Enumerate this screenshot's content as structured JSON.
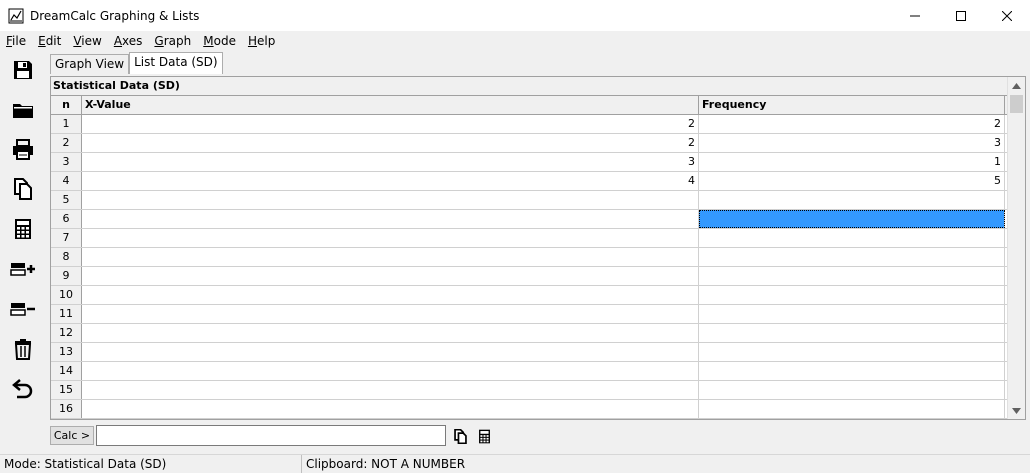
{
  "window": {
    "title": "DreamCalc Graphing & Lists",
    "controls": [
      "minimize-icon",
      "maximize-icon",
      "close-icon"
    ]
  },
  "menubar": {
    "items": [
      {
        "key": "F",
        "rest": "ile"
      },
      {
        "key": "E",
        "rest": "dit"
      },
      {
        "key": "V",
        "rest": "iew"
      },
      {
        "key": "A",
        "rest": "xes"
      },
      {
        "key": "G",
        "rest": "raph"
      },
      {
        "key": "M",
        "rest": "ode"
      },
      {
        "key": "H",
        "rest": "elp"
      }
    ]
  },
  "toolbar": {
    "icons": [
      "save-icon",
      "open-folder-icon",
      "print-icon",
      "copy-icon",
      "calculator-icon",
      "add-row-icon",
      "remove-row-icon",
      "trash-icon",
      "undo-icon"
    ]
  },
  "tabs": [
    {
      "label": "Graph View",
      "active": false
    },
    {
      "label": "List Data (SD)",
      "active": true
    }
  ],
  "grid": {
    "title": "Statistical Data (SD)",
    "columns": [
      "n",
      "X-Value",
      "Frequency"
    ],
    "rows": [
      {
        "n": "1",
        "x": "2",
        "f": "2"
      },
      {
        "n": "2",
        "x": "2",
        "f": "3"
      },
      {
        "n": "3",
        "x": "3",
        "f": "1"
      },
      {
        "n": "4",
        "x": "4",
        "f": "5"
      },
      {
        "n": "5",
        "x": "",
        "f": ""
      },
      {
        "n": "6",
        "x": "",
        "f": ""
      },
      {
        "n": "7",
        "x": "",
        "f": ""
      },
      {
        "n": "8",
        "x": "",
        "f": ""
      },
      {
        "n": "9",
        "x": "",
        "f": ""
      },
      {
        "n": "10",
        "x": "",
        "f": ""
      },
      {
        "n": "11",
        "x": "",
        "f": ""
      },
      {
        "n": "12",
        "x": "",
        "f": ""
      },
      {
        "n": "13",
        "x": "",
        "f": ""
      },
      {
        "n": "14",
        "x": "",
        "f": ""
      },
      {
        "n": "15",
        "x": "",
        "f": ""
      },
      {
        "n": "16",
        "x": "",
        "f": ""
      }
    ],
    "selected_row": "6",
    "selected_col": "Frequency",
    "selection_color": "#3399ff"
  },
  "calcbar": {
    "button_label": "Calc >",
    "input_value": "",
    "icons": [
      "copy-icon",
      "calculator-icon"
    ]
  },
  "statusbar": {
    "mode": "Mode: Statistical Data (SD)",
    "clipboard": "Clipboard: NOT A NUMBER"
  }
}
